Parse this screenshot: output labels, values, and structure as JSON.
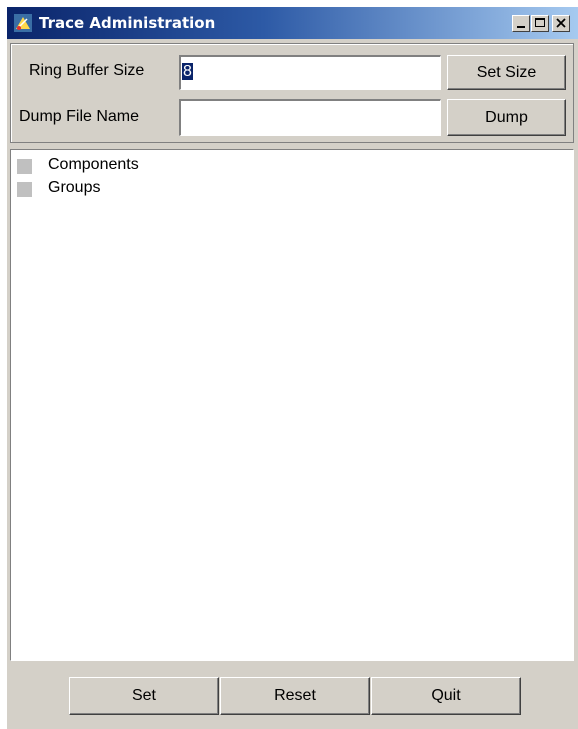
{
  "window": {
    "title": "Trace Administration",
    "controls": [
      "minimize-icon",
      "maximize-icon",
      "close-icon"
    ]
  },
  "ring_buffer": {
    "label": "Ring Buffer Size",
    "value": "8",
    "button": "Set Size"
  },
  "dump_file": {
    "label": "Dump File Name",
    "value": "",
    "button": "Dump"
  },
  "tree": {
    "items": [
      {
        "label": "Components"
      },
      {
        "label": "Groups"
      }
    ]
  },
  "footer": {
    "set_label": "Set",
    "reset_label": "Reset",
    "quit_label": "Quit"
  },
  "colors": {
    "window_bg": "#d4d0c8",
    "title_gradient_start": "#0a246a",
    "title_gradient_end": "#a6caf0",
    "selection": "#0a246a"
  }
}
